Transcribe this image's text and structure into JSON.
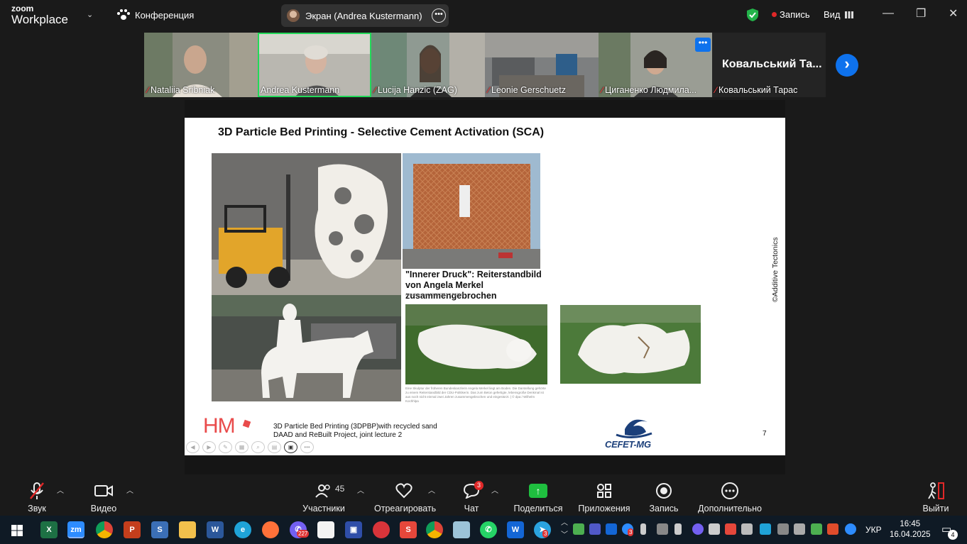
{
  "app": {
    "logo_line1": "zoom",
    "logo_line2": "Workplace",
    "meeting_title": "Конференция",
    "share_pill_label": "Экран (Andrea Kustermann)",
    "record_label": "Запись",
    "view_label": "Вид"
  },
  "participants": [
    {
      "name": "Nataliia Sribniak",
      "active": false
    },
    {
      "name": "Andrea Kustermann",
      "active": true
    },
    {
      "name": "Lucija Hanzic (ZAG)",
      "active": false
    },
    {
      "name": "Leonie Gerschuetz",
      "active": false
    },
    {
      "name": "Циганенко Людмила...",
      "active": false
    },
    {
      "name": "Ковальський Тарас",
      "active": false,
      "big_name": "Ковальський  Та..."
    }
  ],
  "slide": {
    "title": "3D Particle Bed Printing - Selective Cement Activation (SCA)",
    "caption": "\"Innerer Druck\": Reiterstandbild von Angela Merkel zusammengebrochen",
    "caption_small": "Aktualisiert am 14.09.2023, 17:12 Uhr",
    "photo_note": "Eine Skulptur der früheren Bundeskanzlerin Angela Merkel liegt am Boden. Die Darstellung gehörte zu einem Reiterstandbild der CDU-Politikerin. Das zum Beton gefertigte, lebensgroße Denkmal ist aus noch nicht einmal zwei Jahren zusammengebrochen und eingestürzt. | © dpa / Wilhelm Kochhlpa",
    "copyright": "©Additive Tectonics",
    "hm_logo": "HM",
    "footer_line1": "3D Particle Bed Printing (3DPBP)with recycled sand",
    "footer_line2": "DAAD and ReBuilt Project, joint lecture 2",
    "cefet_logo": "CEFET-MG",
    "page_number": "7"
  },
  "toolbar": {
    "audio": "Звук",
    "video": "Видео",
    "participants": "Участники",
    "participants_count": "45",
    "react": "Отреагировать",
    "chat": "Чат",
    "chat_badge": "3",
    "share": "Поделиться",
    "apps": "Приложения",
    "record": "Запись",
    "more": "Дополнительно",
    "leave": "Выйти"
  },
  "taskbar": {
    "viber_badge": "227",
    "telegram_badge": "3",
    "tray_zoom_badge": "3",
    "language": "УКР",
    "time": "16:45",
    "date": "16.04.2025",
    "notifications": "4"
  },
  "colors": {
    "zoom_blue": "#0e72ed",
    "active_green": "#23d959",
    "share_green": "#1fbf3f",
    "alert_red": "#e02828"
  }
}
